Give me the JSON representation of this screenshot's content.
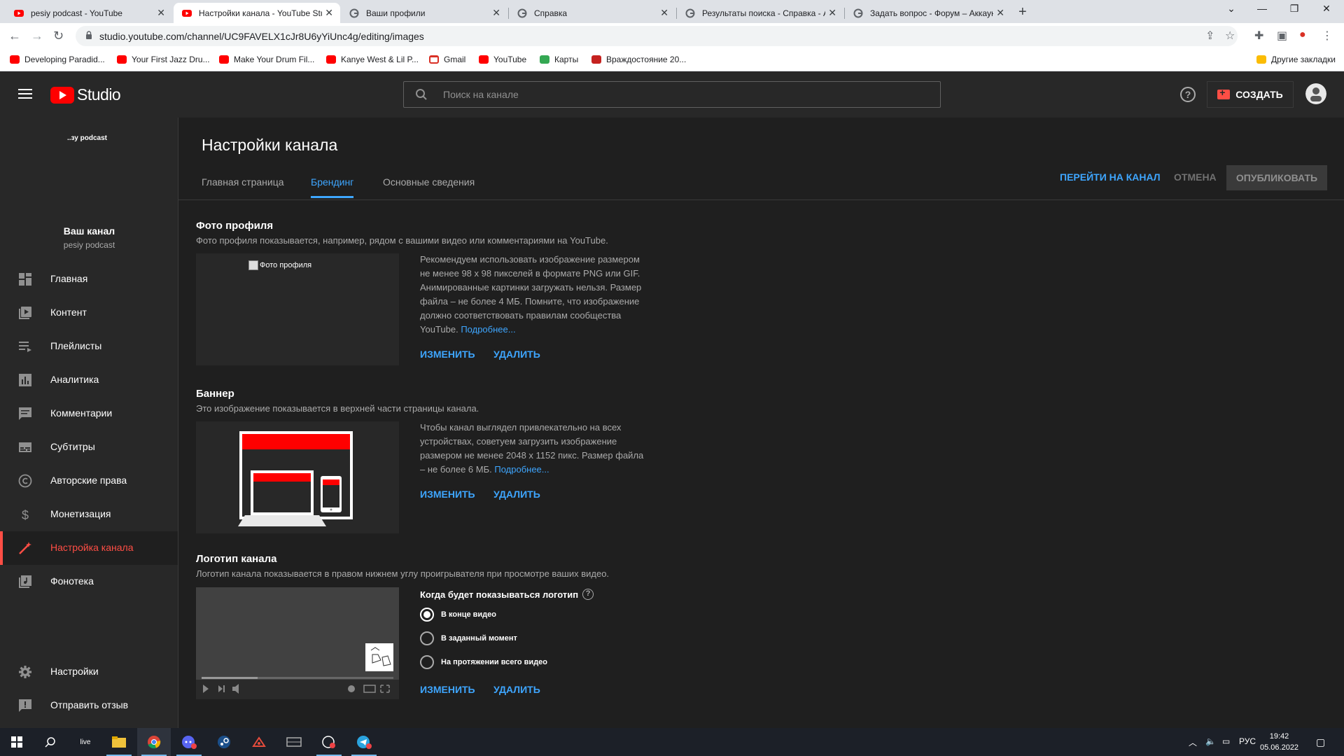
{
  "browser": {
    "tabs": [
      {
        "title": "pesiy podcast - YouTube",
        "favicon": "youtube-icon",
        "active": false
      },
      {
        "title": "Настройки канала - YouTube Studio",
        "favicon": "youtube-icon",
        "active": true
      },
      {
        "title": "Ваши профили",
        "favicon": "google-icon",
        "active": false
      },
      {
        "title": "Справка",
        "favicon": "google-icon",
        "active": false
      },
      {
        "title": "Результаты поиска - Справка - Аккаунт",
        "favicon": "google-icon",
        "active": false
      },
      {
        "title": "Задать вопрос - Форум – Аккаунт Google",
        "favicon": "google-icon",
        "active": false
      }
    ],
    "url": "studio.youtube.com/channel/UC9FAVELX1cJr8U6yYiUnc4g/editing/images",
    "bookmarks": [
      {
        "label": "Developing Paradid...",
        "icon": "youtube-icon"
      },
      {
        "label": "Your First Jazz Dru...",
        "icon": "youtube-icon"
      },
      {
        "label": "Make Your Drum Fil...",
        "icon": "youtube-icon"
      },
      {
        "label": "Kanye West & Lil P...",
        "icon": "youtube-icon"
      },
      {
        "label": "Gmail",
        "icon": "gmail-icon"
      },
      {
        "label": "YouTube",
        "icon": "youtube-icon"
      },
      {
        "label": "Карты",
        "icon": "maps-icon"
      },
      {
        "label": "Враждостояние 20...",
        "icon": "bookmark-icon"
      }
    ],
    "other_bookmarks": "Другие закладки"
  },
  "header": {
    "logo_text": "Studio",
    "search_placeholder": "Поиск на канале",
    "create_label": "СОЗДАТЬ"
  },
  "sidebar": {
    "banner_text": "..зу podcast",
    "channel_title": "Ваш канал",
    "channel_name": "pesiy podcast",
    "items": [
      {
        "label": "Главная",
        "icon": "dashboard-icon",
        "active": false
      },
      {
        "label": "Контент",
        "icon": "content-icon",
        "active": false
      },
      {
        "label": "Плейлисты",
        "icon": "playlists-icon",
        "active": false
      },
      {
        "label": "Аналитика",
        "icon": "analytics-icon",
        "active": false
      },
      {
        "label": "Комментарии",
        "icon": "comments-icon",
        "active": false
      },
      {
        "label": "Субтитры",
        "icon": "subtitles-icon",
        "active": false
      },
      {
        "label": "Авторские права",
        "icon": "copyright-icon",
        "active": false
      },
      {
        "label": "Монетизация",
        "icon": "dollar-icon",
        "active": false
      },
      {
        "label": "Настройка канала",
        "icon": "customization-wand-icon",
        "active": true
      },
      {
        "label": "Фонотека",
        "icon": "audio-library-icon",
        "active": false
      }
    ],
    "bottom_items": [
      {
        "label": "Настройки",
        "icon": "gear-icon"
      },
      {
        "label": "Отправить отзыв",
        "icon": "feedback-icon"
      }
    ]
  },
  "main": {
    "title": "Настройки канала",
    "tabs": [
      {
        "label": "Главная страница",
        "active": false
      },
      {
        "label": "Брендинг",
        "active": true
      },
      {
        "label": "Основные сведения",
        "active": false
      }
    ],
    "go_to_channel": "ПЕРЕЙТИ НА КАНАЛ",
    "cancel": "ОТМЕНА",
    "publish": "ОПУБЛИКОВАТЬ",
    "profile_photo": {
      "title": "Фото профиля",
      "description": "Фото профиля показывается, например, рядом с вашими видео или комментариями на YouTube.",
      "alt_text": "Фото профиля",
      "info": "Рекомендуем использовать изображение размером не менее 98 х 98 пикселей в формате PNG или GIF. Анимированные картинки загружать нельзя. Размер файла – не более 4 МБ. Помните, что изображение должно соответствовать правилам сообщества YouTube.",
      "learn_more": "Подробнее...",
      "change": "ИЗМЕНИТЬ",
      "delete": "УДАЛИТЬ"
    },
    "banner": {
      "title": "Баннер",
      "description": "Это изображение показывается в верхней части страницы канала.",
      "info": "Чтобы канал выглядел привлекательно на всех устройствах, советуем загрузить изображение размером не менее 2048 х 1152 пикс. Размер файла – не более 6 МБ.",
      "learn_more": "Подробнее...",
      "change": "ИЗМЕНИТЬ",
      "delete": "УДАЛИТЬ"
    },
    "logo": {
      "title": "Логотип канала",
      "description": "Логотип канала показывается в правом нижнем углу проигрывателя при просмотре ваших видео.",
      "question": "Когда будет показываться логотип",
      "options": [
        {
          "label": "В конце видео",
          "checked": true
        },
        {
          "label": "В заданный момент",
          "checked": false
        },
        {
          "label": "На протяжении всего видео",
          "checked": false
        }
      ],
      "change": "ИЗМЕНИТЬ",
      "delete": "УДАЛИТЬ"
    }
  },
  "taskbar": {
    "search_app": "live",
    "language": "РУС",
    "time": "19:42",
    "date": "05.06.2022"
  }
}
